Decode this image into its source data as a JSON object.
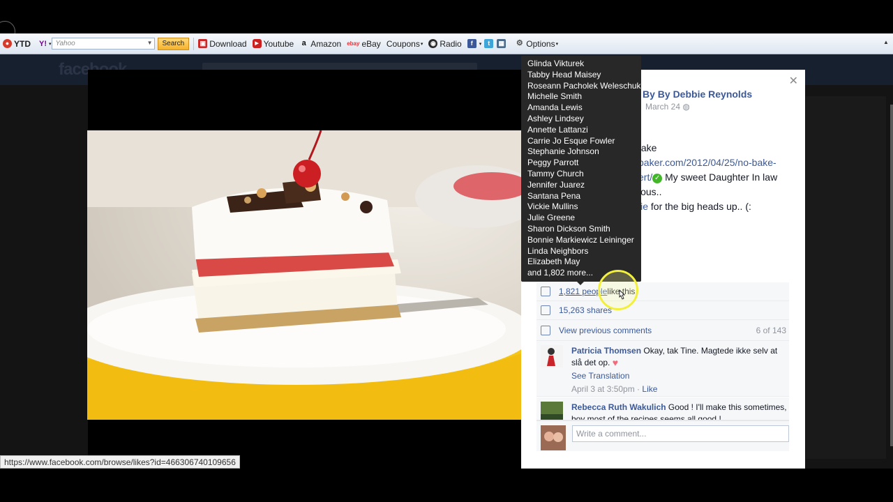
{
  "toolbar": {
    "ytd_label": "YTD",
    "yahoo_logo": "Y!",
    "yahoo_placeholder": "Yahoo",
    "search_label": "Search",
    "download_label": "Download",
    "youtube_label": "Youtube",
    "amazon_label": "Amazon",
    "ebay_logo": "ebay",
    "ebay_label": "eBay",
    "coupons_label": "Coupons",
    "radio_label": "Radio",
    "options_label": "Options"
  },
  "background": {
    "logo": "facebook"
  },
  "post": {
    "author": "By By Debbie Reynolds",
    "date": "March 24",
    "line1": "take",
    "line2_link": "baker.com/2012/04/25/no-bake-",
    "line3_link": "ert/",
    "line3_rest": " My sweet Daughter In law",
    "line4": "ious..",
    "line5_link": "lie",
    "line5_rest": " for the big heads up.. (:"
  },
  "stats": {
    "likes_count": "1,821 people",
    "likes_rest": " like this.",
    "shares": "15,263 shares",
    "view_previous": "View previous comments",
    "comment_count": "6 of 143"
  },
  "comments": [
    {
      "name": "Patricia Thomsen",
      "text": " Okay, tak Tine. Magtede ikke selv at slå det op.",
      "see_translation": "See Translation",
      "time": "April 3 at 3:50pm",
      "like": "Like"
    },
    {
      "name": "Rebecca Ruth Wakulich",
      "text": " Good ! I'll make this sometimes, boy most of the recipes seems all good !"
    }
  ],
  "write_comment_placeholder": "Write a comment...",
  "likers": [
    "Glinda Vikturek",
    "Tabby Head Maisey",
    "Roseann Pacholek Weleschuk",
    "Michelle Smith",
    "Amanda Lewis",
    "Ashley Lindsey",
    "Annette Lattanzi",
    "Carrie Jo Esque Fowler",
    "Stephanie Johnson",
    "Peggy Parrott",
    "Tammy Church",
    "Jennifer Juarez",
    "Santana Pena",
    "Vickie Mullins",
    "Julie Greene",
    "Sharon Dickson Smith",
    "Bonnie Markiewicz Leininger",
    "Linda Neighbors",
    "Elizabeth May",
    "and 1,802 more..."
  ],
  "status_url": "https://www.facebook.com/browse/likes?id=466306740109656"
}
